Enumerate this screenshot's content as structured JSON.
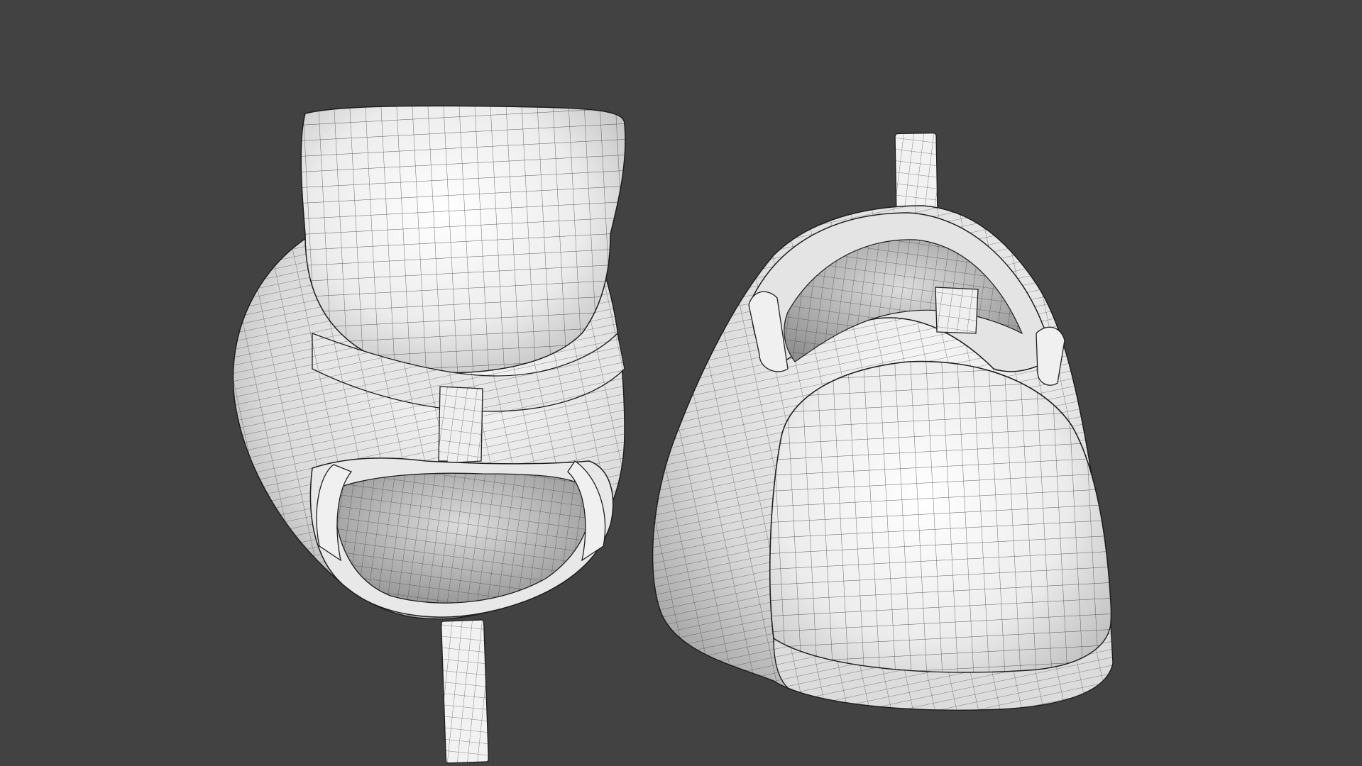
{
  "scene": {
    "background_color": "#424242",
    "mesh_base_color": "#f2f2f2",
    "mesh_shade_color": "#c4c4c4",
    "wireframe_color": "#2a2a2a",
    "objects": [
      "left-shoe-mesh",
      "right-shoe-mesh"
    ]
  }
}
